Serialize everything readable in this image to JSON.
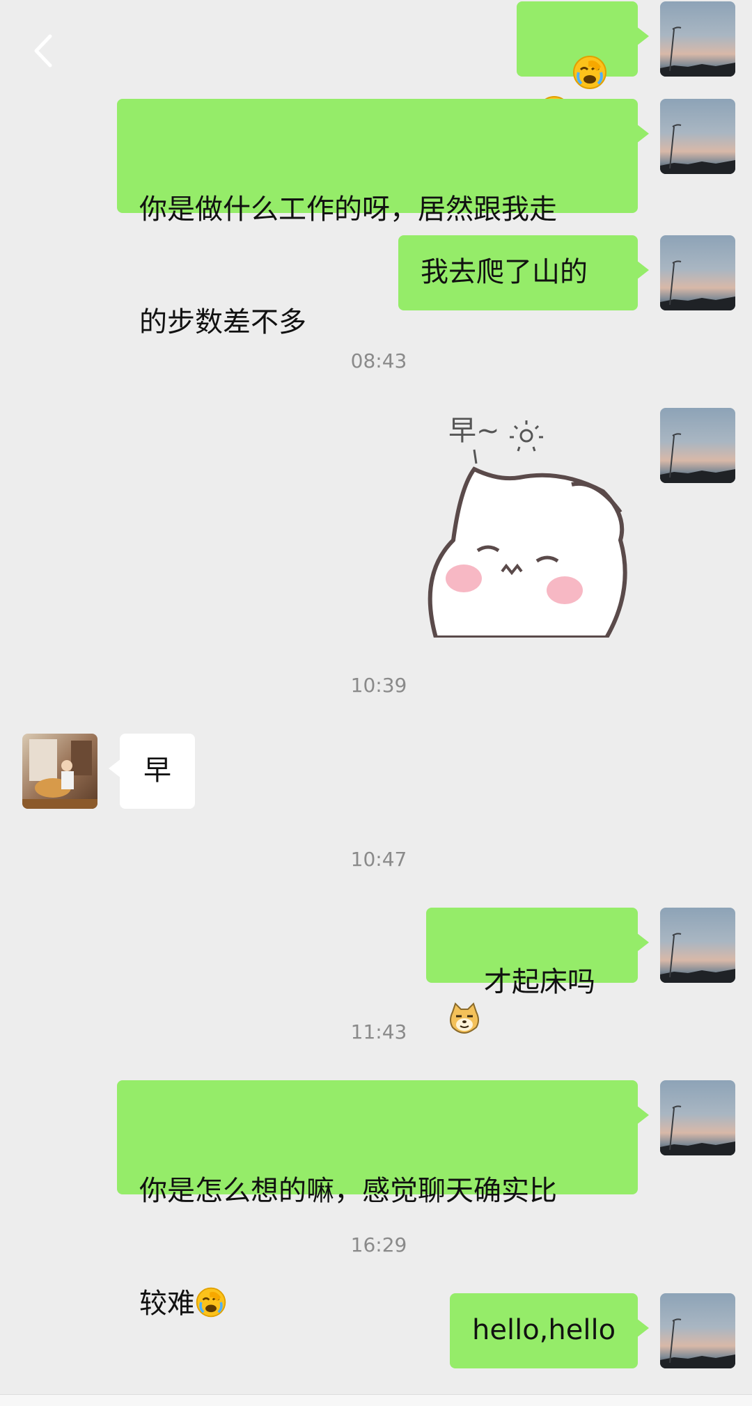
{
  "header": {
    "back_icon": "chevron-left-icon"
  },
  "messages": [
    {
      "side": "me",
      "type": "emoji",
      "content": "😭😭"
    },
    {
      "side": "me",
      "type": "text",
      "line1": "你是做什么工作的呀，居然跟我走",
      "line2": "的步数差不多"
    },
    {
      "side": "me",
      "type": "text",
      "content": "我去爬了山的"
    },
    {
      "type": "time",
      "content": "08:43"
    },
    {
      "side": "me",
      "type": "sticker",
      "content": "早~"
    },
    {
      "type": "time",
      "content": "10:39"
    },
    {
      "side": "other",
      "type": "text",
      "content": "早"
    },
    {
      "type": "time",
      "content": "10:47"
    },
    {
      "side": "me",
      "type": "text",
      "content": "才起床吗"
    },
    {
      "type": "time",
      "content": "11:43"
    },
    {
      "side": "me",
      "type": "text",
      "line1": "你是怎么想的嘛，感觉聊天确实比",
      "line2": "较难"
    },
    {
      "type": "time",
      "content": "16:29"
    },
    {
      "side": "me",
      "type": "text",
      "content": "hello,hello"
    }
  ],
  "colors": {
    "background": "#ededed",
    "my_bubble": "#95ec69",
    "their_bubble": "#ffffff",
    "timestamp": "#8a8a8a"
  }
}
